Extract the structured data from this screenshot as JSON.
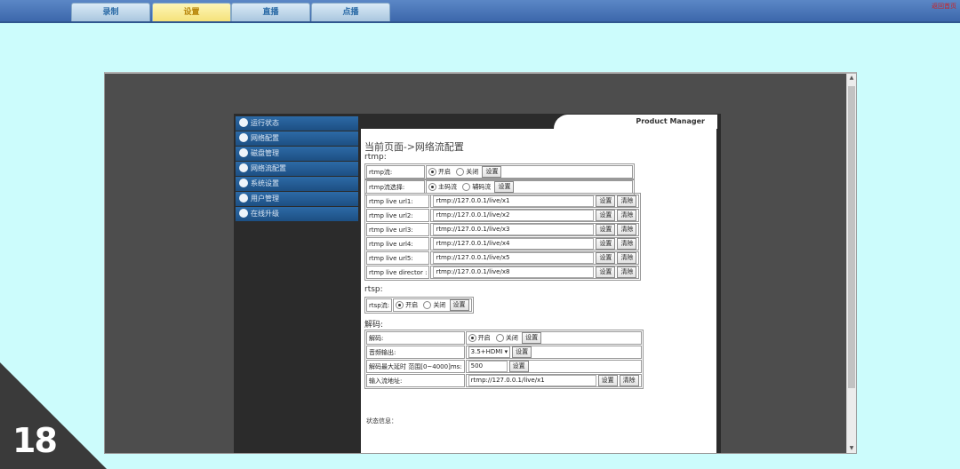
{
  "top_tabs": [
    "录制",
    "设置",
    "直播",
    "点播"
  ],
  "corner_link": "返回首页",
  "product_title": "Product Manager",
  "sidebar": [
    "运行状态",
    "网络配置",
    "磁盘管理",
    "网络流配置",
    "系统设置",
    "用户管理",
    "在线升级"
  ],
  "page_title": "当前页面->网络流配置",
  "rtmp": {
    "section": "rtmp:",
    "stream_label": "rtmp流:",
    "on": "开启",
    "off": "关闭",
    "set": "设置",
    "select_label": "rtmp流选择:",
    "main": "主码流",
    "sub": "辅码流",
    "clear": "清除",
    "urls": [
      {
        "label": "rtmp live url1:",
        "value": "rtmp://127.0.0.1/live/x1"
      },
      {
        "label": "rtmp live url2:",
        "value": "rtmp://127.0.0.1/live/x2"
      },
      {
        "label": "rtmp live url3:",
        "value": "rtmp://127.0.0.1/live/x3"
      },
      {
        "label": "rtmp live url4:",
        "value": "rtmp://127.0.0.1/live/x4"
      },
      {
        "label": "rtmp live url5:",
        "value": "rtmp://127.0.0.1/live/x5"
      },
      {
        "label": "rtmp live director :",
        "value": "rtmp://127.0.0.1/live/x8"
      }
    ]
  },
  "rtsp": {
    "section": "rtsp:",
    "label": "rtsp流:",
    "on": "开启",
    "off": "关闭",
    "set": "设置"
  },
  "decode": {
    "section": "解码:",
    "decode_label": "解码:",
    "on": "开启",
    "off": "关闭",
    "set": "设置",
    "audio_label": "音频输出:",
    "audio_value": "3.5+HDMI",
    "delay_label": "解码最大延时 范围[0~4000]ms:",
    "delay_value": "500",
    "input_label": "输入流地址:",
    "input_value": "rtmp://127.0.0.1/live/x1",
    "clear": "清除"
  },
  "status_label": "状态信息：",
  "corner_mark": "18"
}
